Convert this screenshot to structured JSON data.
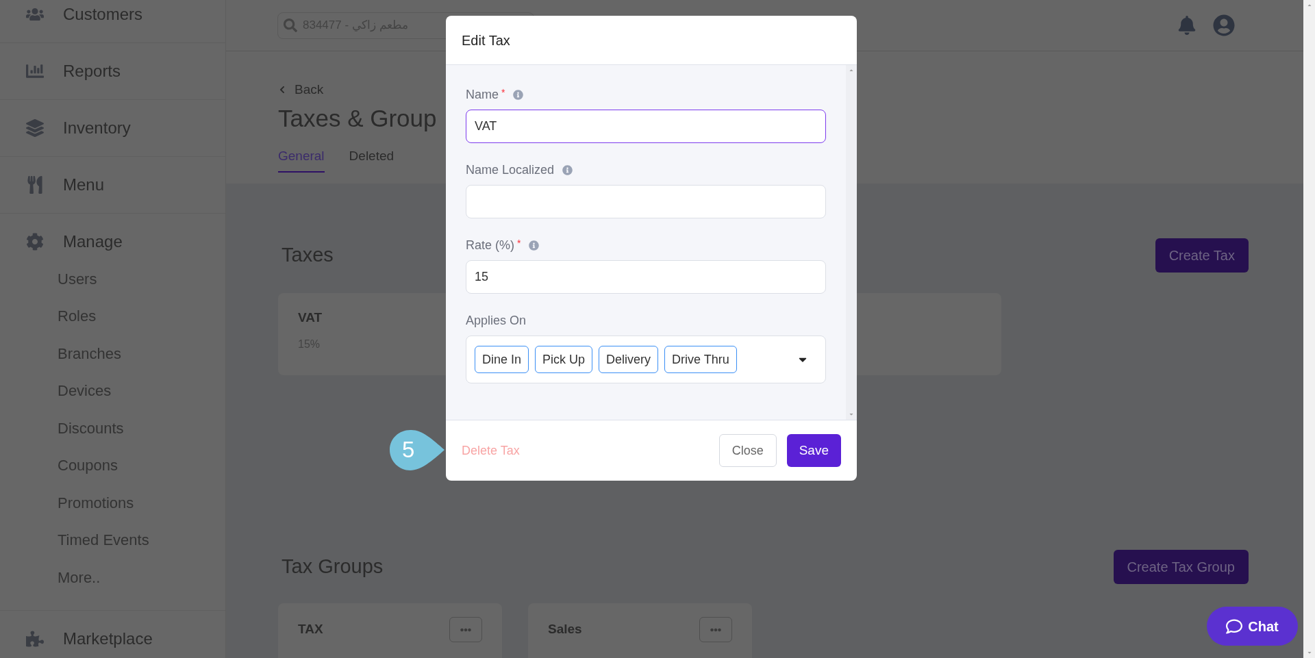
{
  "sidebar": {
    "items": [
      {
        "label": "Customers"
      },
      {
        "label": "Reports"
      },
      {
        "label": "Inventory"
      },
      {
        "label": "Menu"
      },
      {
        "label": "Manage",
        "children": [
          {
            "label": "Users"
          },
          {
            "label": "Roles"
          },
          {
            "label": "Branches"
          },
          {
            "label": "Devices"
          },
          {
            "label": "Discounts"
          },
          {
            "label": "Coupons"
          },
          {
            "label": "Promotions"
          },
          {
            "label": "Timed Events"
          },
          {
            "label": "More.."
          }
        ]
      },
      {
        "label": "Marketplace"
      }
    ]
  },
  "header": {
    "search": {
      "value": "مطعم زاكي - 834477"
    }
  },
  "page": {
    "back": "Back",
    "title": "Taxes & Group",
    "tabs": [
      {
        "label": "General",
        "selected": true
      },
      {
        "label": "Deleted",
        "selected": false
      }
    ],
    "taxes": {
      "title": "Taxes",
      "button": "Create Tax",
      "cards": [
        {
          "name": "VAT",
          "rate": "15%"
        }
      ]
    },
    "tax_groups": {
      "title": "Tax Groups",
      "button": "Create Tax Group",
      "cards": [
        {
          "name": "TAX"
        },
        {
          "name": "Sales"
        }
      ]
    }
  },
  "modal": {
    "title": "Edit Tax",
    "fields": [
      {
        "kind": "text",
        "label": "Name",
        "required_mark": "*",
        "value": "VAT",
        "focused": true
      },
      {
        "kind": "text",
        "label": "Name Localized",
        "focused": false
      },
      {
        "kind": "text",
        "label": "Rate (%)",
        "required_mark": "*",
        "value": "15",
        "focused": false
      },
      {
        "kind": "multiselect",
        "label": "Applies On",
        "tags": [
          "Dine In",
          "Pick Up",
          "Delivery",
          "Drive Thru"
        ]
      }
    ],
    "delete": "Delete Tax",
    "close": "Close",
    "save": "Save"
  },
  "callout": {
    "step": "5"
  },
  "chat": {
    "label": "Chat"
  }
}
